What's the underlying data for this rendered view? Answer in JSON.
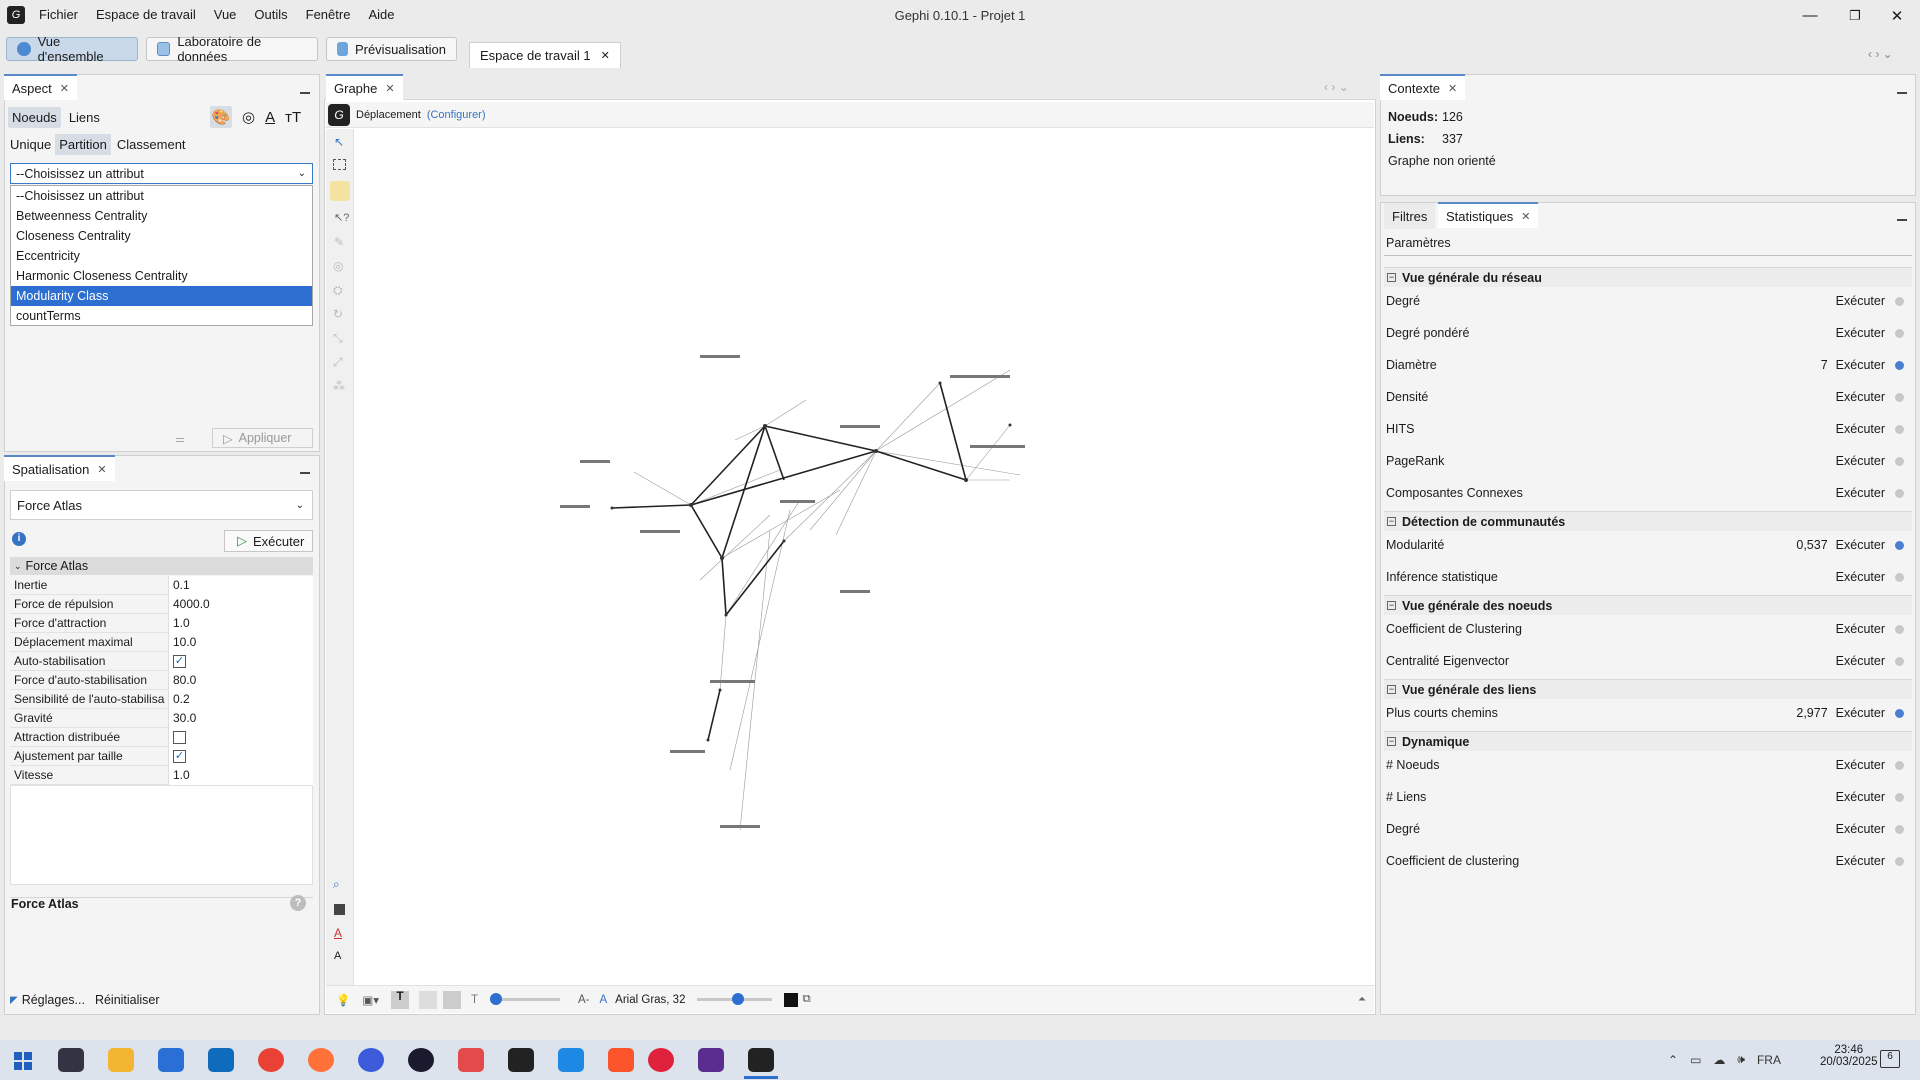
{
  "window": {
    "title": "Gephi 0.10.1 - Projet 1"
  },
  "menu": [
    "Fichier",
    "Espace de travail",
    "Vue",
    "Outils",
    "Fenêtre",
    "Aide"
  ],
  "toolbar": {
    "overview": "Vue d'ensemble",
    "data_lab": "Laboratoire de données",
    "preview": "Prévisualisation",
    "workspace_tab": "Espace de travail 1"
  },
  "aspect": {
    "tab": "Aspect",
    "subtabs": [
      "Noeuds",
      "Liens"
    ],
    "modes": [
      "Unique",
      "Partition",
      "Classement"
    ],
    "select_value": "--Choisissez un attribut",
    "options": [
      "--Choisissez un attribut",
      "Betweenness Centrality",
      "Closeness Centrality",
      "Eccentricity",
      "Harmonic Closeness Centrality",
      "Modularity Class",
      "countTerms"
    ],
    "apply": "Appliquer"
  },
  "layout": {
    "tab": "Spatialisation",
    "algorithm": "Force Atlas",
    "run": "Exécuter",
    "section": "Force Atlas",
    "params": [
      {
        "label": "Inertie",
        "value": "0.1"
      },
      {
        "label": "Force de répulsion",
        "value": "4000.0"
      },
      {
        "label": "Force d'attraction",
        "value": "1.0"
      },
      {
        "label": "Déplacement maximal",
        "value": "10.0"
      },
      {
        "label": "Auto-stabilisation",
        "value": "",
        "checked": true
      },
      {
        "label": "Force d'auto-stabilisation",
        "value": "80.0"
      },
      {
        "label": "Sensibilité de l'auto-stabilisa",
        "value": "0.2"
      },
      {
        "label": "Gravité",
        "value": "30.0"
      },
      {
        "label": "Attraction distribuée",
        "value": "",
        "checked": false
      },
      {
        "label": "Ajustement par taille",
        "value": "",
        "checked": true
      },
      {
        "label": "Vitesse",
        "value": "1.0"
      }
    ],
    "desc_title": "Force Atlas",
    "settings": "Réglages...",
    "reset": "Réinitialiser"
  },
  "graph": {
    "tab": "Graphe",
    "tool": "Déplacement",
    "configure": "(Configurer)",
    "font": "Arial Gras, 32"
  },
  "context": {
    "tab": "Contexte",
    "nodes_label": "Noeuds:",
    "nodes": "126",
    "edges_label": "Liens:",
    "edges": "337",
    "type": "Graphe non orienté"
  },
  "stats": {
    "tabs": [
      "Filtres",
      "Statistiques"
    ],
    "params": "Paramètres",
    "run": "Exécuter",
    "groups": [
      {
        "title": "Vue générale du réseau",
        "items": [
          {
            "label": "Degré",
            "value": ""
          },
          {
            "label": "Degré pondéré",
            "value": ""
          },
          {
            "label": "Diamètre",
            "value": "7"
          },
          {
            "label": "Densité",
            "value": ""
          },
          {
            "label": "HITS",
            "value": ""
          },
          {
            "label": "PageRank",
            "value": ""
          },
          {
            "label": "Composantes Connexes",
            "value": ""
          }
        ]
      },
      {
        "title": "Détection de communautés",
        "items": [
          {
            "label": "Modularité",
            "value": "0,537"
          },
          {
            "label": "Inférence statistique",
            "value": ""
          }
        ]
      },
      {
        "title": "Vue générale des noeuds",
        "items": [
          {
            "label": "Coefficient de Clustering",
            "value": ""
          },
          {
            "label": "Centralité Eigenvector",
            "value": ""
          }
        ]
      },
      {
        "title": "Vue générale des liens",
        "items": [
          {
            "label": "Plus courts chemins",
            "value": "2,977"
          }
        ]
      },
      {
        "title": "Dynamique",
        "items": [
          {
            "label": "# Noeuds",
            "value": ""
          },
          {
            "label": "# Liens",
            "value": ""
          },
          {
            "label": "Degré",
            "value": ""
          },
          {
            "label": "Coefficient de clustering",
            "value": ""
          }
        ]
      }
    ]
  },
  "taskbar": {
    "lang": "FRA",
    "time": "23:46",
    "date": "20/03/2025",
    "notif": "6"
  },
  "colors": {
    "accent": "#3574c4",
    "selection": "#2c6fd0"
  }
}
